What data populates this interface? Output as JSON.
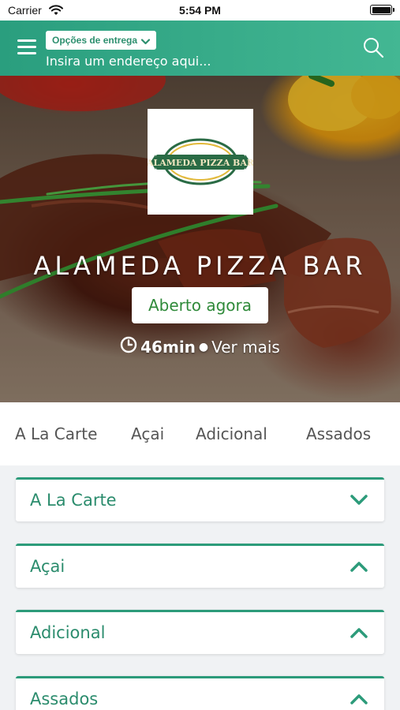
{
  "status_bar": {
    "carrier": "Carrier",
    "time": "5:54 PM"
  },
  "header": {
    "delivery_options_label": "Opções de entrega",
    "address_placeholder": "Insira um endereço aqui..."
  },
  "hero": {
    "logo_text": "ALAMEDA PIZZA BAR",
    "restaurant_name": "ALAMEDA PIZZA BAR",
    "status_badge": "Aberto agora",
    "delivery_time": "46min",
    "separator": "●",
    "see_more": "Ver mais"
  },
  "tabs": [
    {
      "label": "A La Carte"
    },
    {
      "label": "Açai"
    },
    {
      "label": "Adicional"
    },
    {
      "label": "Assados"
    }
  ],
  "sections": [
    {
      "title": "A La Carte",
      "state": "expanded"
    },
    {
      "title": "Açai",
      "state": "collapsed"
    },
    {
      "title": "Adicional",
      "state": "collapsed"
    },
    {
      "title": "Assados",
      "state": "collapsed"
    }
  ],
  "colors": {
    "accent": "#2c9b7a",
    "header_start": "#2a9e7e",
    "header_end": "#43b793",
    "badge_text": "#2f8a3a"
  },
  "icons": [
    "wifi-icon",
    "battery-icon",
    "menu-icon",
    "chevron-down-icon",
    "search-icon",
    "clock-icon",
    "chevron-up-icon"
  ]
}
